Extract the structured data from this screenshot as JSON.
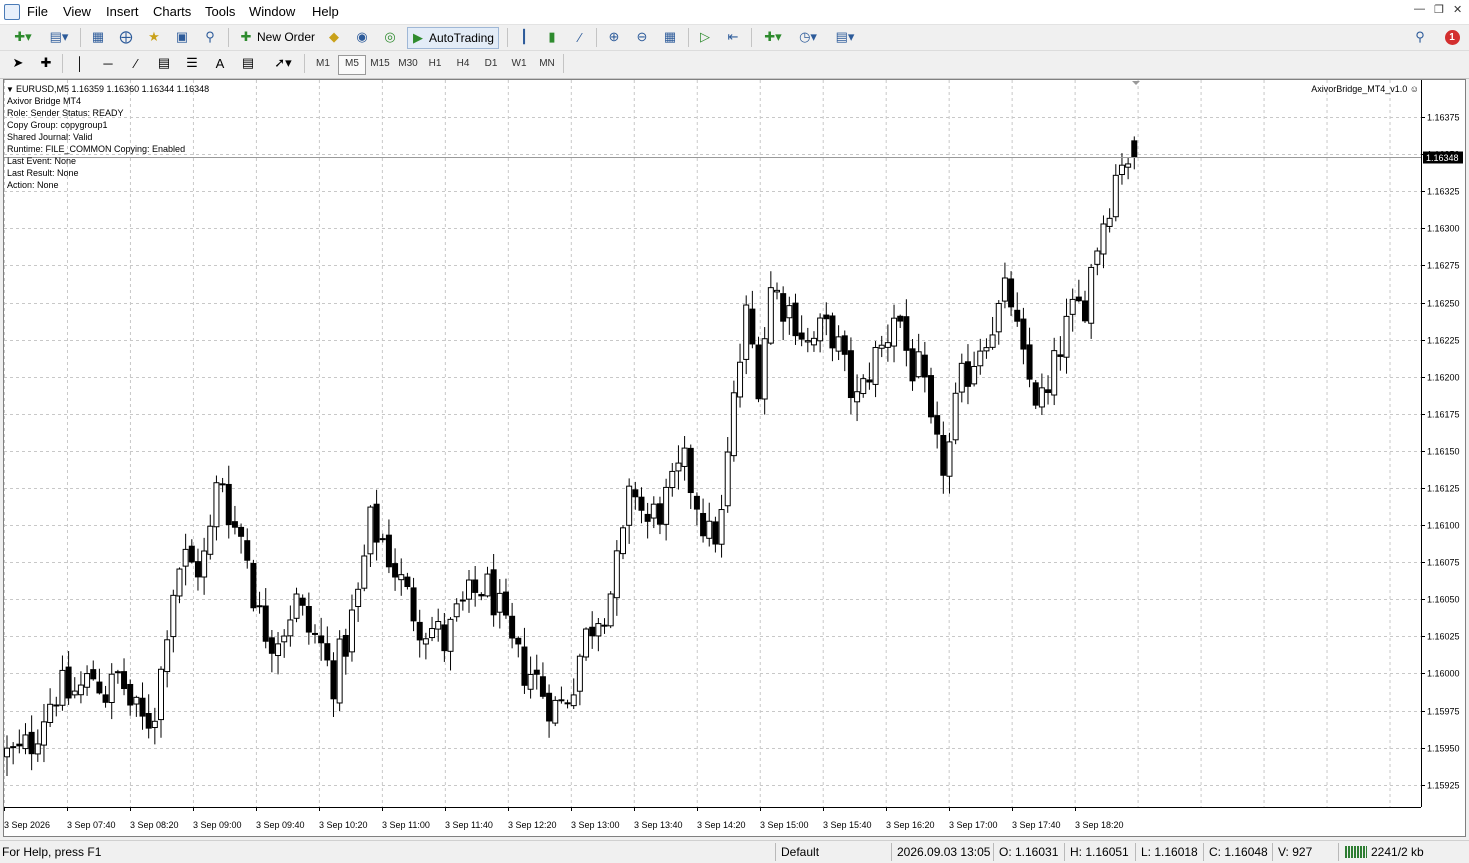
{
  "menu": {
    "items": [
      "File",
      "View",
      "Insert",
      "Charts",
      "Tools",
      "Window",
      "Help"
    ]
  },
  "toolbar": {
    "new_order_label": "New Order",
    "autotrading_label": "AutoTrading",
    "notification_count": "1"
  },
  "timeframes": {
    "items": [
      "M1",
      "M5",
      "M15",
      "M30",
      "H1",
      "H4",
      "D1",
      "W1",
      "MN"
    ],
    "active": "M5"
  },
  "chart": {
    "header": "EURUSD,M5  1.16359 1.16360 1.16344 1.16348",
    "ea_label": "AxivorBridge_MT4_v1.0",
    "info_lines": [
      "Axivor Bridge MT4",
      "Role: Sender    Status: READY",
      "Copy Group: copygroup1",
      "Shared Journal: Valid",
      "Runtime: FILE_COMMON    Copying: Enabled",
      "Last Event: None",
      "Last Result: None",
      "Action: None"
    ],
    "current_price": "1.16348"
  },
  "chart_data": {
    "type": "candlestick",
    "symbol": "EURUSD",
    "timeframe": "M5",
    "ylim": [
      1.1591,
      1.164
    ],
    "grid": true,
    "y_ticks": [
      "1.16375",
      "1.16350",
      "1.16325",
      "1.16300",
      "1.16275",
      "1.16250",
      "1.16225",
      "1.16200",
      "1.16175",
      "1.16150",
      "1.16125",
      "1.16100",
      "1.16075",
      "1.16050",
      "1.16025",
      "1.16000",
      "1.15975",
      "1.15950",
      "1.15925"
    ],
    "x_ticks": [
      "3 Sep 2026",
      "3 Sep 07:40",
      "3 Sep 08:20",
      "3 Sep 09:00",
      "3 Sep 09:40",
      "3 Sep 10:20",
      "3 Sep 11:00",
      "3 Sep 11:40",
      "3 Sep 12:20",
      "3 Sep 13:00",
      "3 Sep 13:40",
      "3 Sep 14:20",
      "3 Sep 15:00",
      "3 Sep 15:40",
      "3 Sep 16:20",
      "3 Sep 17:00",
      "3 Sep 17:40",
      "3 Sep 18:20"
    ],
    "close_path": [
      1.15945,
      1.15945,
      1.15955,
      1.15975,
      1.1599,
      1.15985,
      1.1599,
      1.16,
      1.15985,
      1.16,
      1.15975,
      1.15965,
      1.1598,
      1.1605,
      1.1608,
      1.1607,
      1.1608,
      1.1614,
      1.161,
      1.1609,
      1.1604,
      1.16025,
      1.1603,
      1.1605,
      1.1603,
      1.1602,
      1.15995,
      1.1602,
      1.1605,
      1.161,
      1.1609,
      1.1607,
      1.1605,
      1.16035,
      1.1603,
      1.1602,
      1.1604,
      1.1605,
      1.1606,
      1.1605,
      1.1602,
      1.16005,
      1.16,
      1.15985,
      1.15975,
      1.1599,
      1.1602,
      1.1604,
      1.1605,
      1.1608,
      1.1613,
      1.161,
      1.1611,
      1.1612,
      1.1614,
      1.1612,
      1.1609,
      1.161,
      1.1618,
      1.1624,
      1.162,
      1.1626,
      1.1625,
      1.1624,
      1.1622,
      1.1623,
      1.1623,
      1.162,
      1.1618,
      1.1621,
      1.1622,
      1.1625,
      1.1621,
      1.162,
      1.1615,
      1.1614,
      1.1619,
      1.1621,
      1.1623,
      1.1624,
      1.1626,
      1.1621,
      1.1619,
      1.1618,
      1.1622,
      1.1624,
      1.1625,
      1.1629,
      1.1632,
      1.1635,
      1.16348
    ]
  },
  "status": {
    "help_text": "For Help, press F1",
    "profile": "Default",
    "datetime": "2026.09.03 13:05",
    "open": "O: 1.16031",
    "high": "H: 1.16051",
    "low": "L: 1.16018",
    "close": "C: 1.16048",
    "volume": "V: 927",
    "traffic": "2241/2 kb"
  },
  "colors": {
    "bull_fill": "#ffffff",
    "bear_fill": "#000000",
    "grid": "#c8c8c8",
    "notification": "#d32f2f"
  }
}
